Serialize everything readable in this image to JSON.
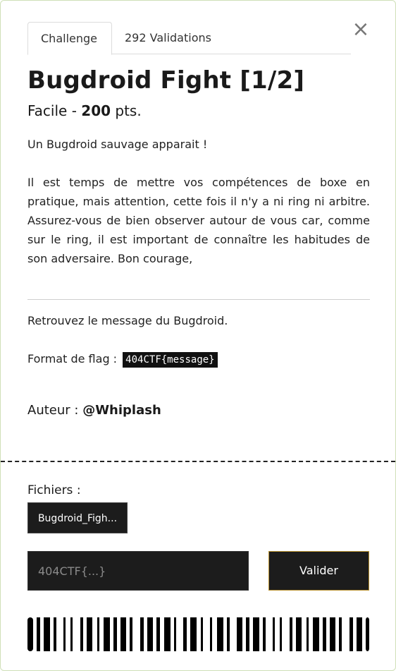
{
  "tabs": [
    {
      "label": "Challenge",
      "active": true
    },
    {
      "label": "292 Validations",
      "active": false
    }
  ],
  "close_icon": "×",
  "challenge": {
    "title": "Bugdroid Fight [1/2]",
    "difficulty": "Facile",
    "separator": " - ",
    "points": "200",
    "points_suffix": " pts.",
    "description": [
      "Un Bugdroid sauvage apparait !",
      "Il est temps de mettre vos compétences de boxe en pratique, mais attention, cette fois il n'y a ni ring ni arbitre. Assurez-vous de bien observer autour de vous car, comme sur le ring, il est important de connaître les habitudes de son adversaire. Bon courage,"
    ],
    "objective": "Retrouvez le message du Bugdroid.",
    "flag_format_label": "Format de flag :",
    "flag_format": "404CTF{message}",
    "author_label": "Auteur :",
    "author": "@Whiplash"
  },
  "files": {
    "label": "Fichiers :",
    "items": [
      "Bugdroid_Figh..."
    ]
  },
  "submit_form": {
    "placeholder": "404CTF{...}",
    "button_label": "Valider"
  },
  "colors": {
    "dark": "#1c1c1c",
    "submit_border": "#b8912f",
    "modal_border": "#cfe0b8"
  }
}
